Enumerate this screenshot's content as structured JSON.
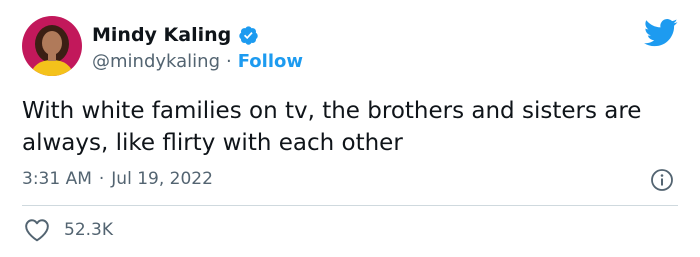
{
  "author": {
    "display_name": "Mindy Kaling",
    "handle": "@mindykaling",
    "separator": "·",
    "follow_label": "Follow",
    "verified": true
  },
  "tweet": {
    "text": "With white families on tv, the brothers and sisters are always, like flirty with each other",
    "time": "3:31 AM",
    "date_separator": "·",
    "date": "Jul 19, 2022",
    "like_count": "52.3K"
  },
  "icons": {
    "brand": "twitter-bird-icon",
    "verified": "verified-badge-icon",
    "info": "info-icon",
    "like": "heart-icon"
  },
  "colors": {
    "brand_blue": "#1d9bf0",
    "text_primary": "#0f1419",
    "text_secondary": "#536471",
    "divider": "#cfd9de",
    "avatar_background": "#c2185b"
  }
}
